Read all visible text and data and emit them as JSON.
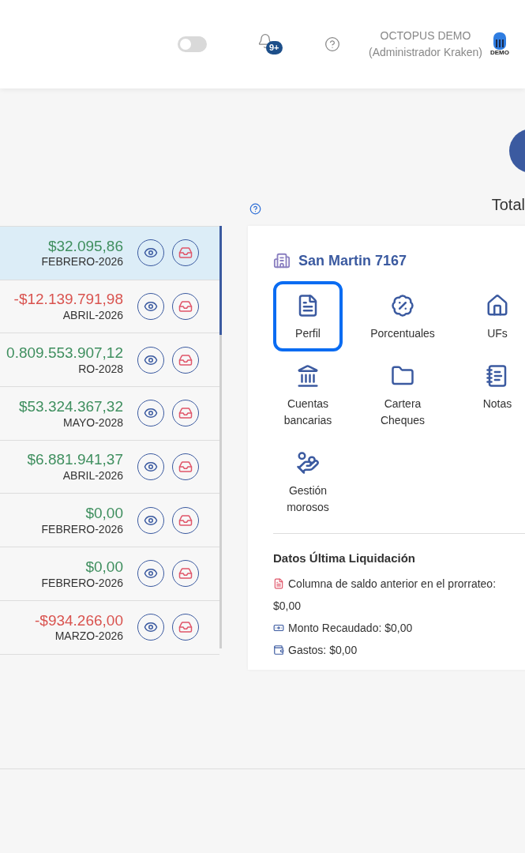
{
  "header": {
    "dark_mode_toggle": {
      "on": false
    },
    "notifications_badge": "9+",
    "user": {
      "name": "OCTOPUS DEMO",
      "role": "(Administrador Kraken)"
    },
    "logo_text": "DEMO"
  },
  "summary": {
    "label": "Total"
  },
  "rows": [
    {
      "amount": "$32.095,86",
      "period": "FEBRERO-2026",
      "color": "#3f8f5f",
      "selected": true
    },
    {
      "amount": "-$12.139.791,98",
      "period": "ABRIL-2026",
      "color": "#d9534f",
      "selected": false
    },
    {
      "amount": "0.809.553.907,12",
      "period": "RO-2028",
      "color": "#3f8f5f",
      "selected": false
    },
    {
      "amount": "$53.324.367,32",
      "period": "MAYO-2028",
      "color": "#3f8f5f",
      "selected": false
    },
    {
      "amount": "$6.881.941,37",
      "period": "ABRIL-2026",
      "color": "#3f8f5f",
      "selected": false
    },
    {
      "amount": "$0,00",
      "period": "FEBRERO-2026",
      "color": "#3f8f5f",
      "selected": false
    },
    {
      "amount": "$0,00",
      "period": "FEBRERO-2026",
      "color": "#3f8f5f",
      "selected": false
    },
    {
      "amount": "-$934.266,00",
      "period": "MARZO-2026",
      "color": "#d9534f",
      "selected": false
    }
  ],
  "building": {
    "title": "San Martin 7167",
    "shortcuts": [
      {
        "kind": "profile",
        "label": "Perfil",
        "selected": true
      },
      {
        "kind": "percent",
        "label": "Porcentuales",
        "selected": false
      },
      {
        "kind": "house",
        "label": "UFs",
        "selected": false
      },
      {
        "kind": "bank",
        "label": "Cuentas bancarias",
        "selected": false
      },
      {
        "kind": "folder",
        "label": "Cartera Cheques",
        "selected": false
      },
      {
        "kind": "notes",
        "label": "Notas",
        "selected": false
      },
      {
        "kind": "debtors",
        "label": "Gestión morosos",
        "selected": false
      }
    ],
    "last_settlement": {
      "title": "Datos Última Liquidación",
      "items": [
        {
          "kind": "document",
          "text": "Columna de saldo anterior en el prorrateo:",
          "value": "$0,00"
        },
        {
          "kind": "money",
          "text": "Monto Recaudado: $0,00"
        },
        {
          "kind": "expense",
          "text": "Gastos: $0,00"
        }
      ]
    }
  }
}
